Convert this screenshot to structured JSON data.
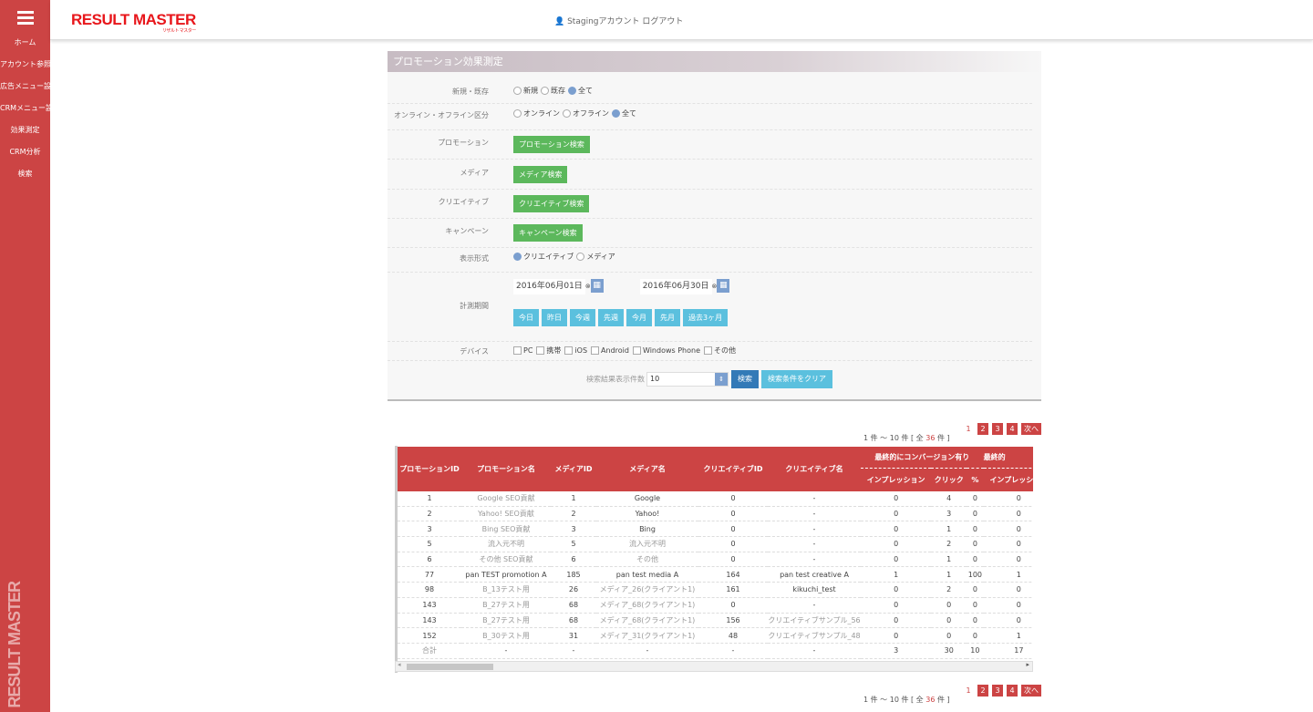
{
  "sidebar": {
    "items": [
      "ホーム",
      "アカウント参照",
      "広告メニュー設定",
      "CRMメニュー設...",
      "効果測定",
      "CRM分析",
      "検索"
    ],
    "vertical_logo": "RESULT MASTER"
  },
  "header": {
    "logo": "RESULT MASTER",
    "logo_sub": "リザルト マスター",
    "account": "Stagingアカウント",
    "logout": "ログアウト"
  },
  "panel": {
    "title": "プロモーション効果測定",
    "new_existing": {
      "label": "新規・既存",
      "options": [
        "新規",
        "既存",
        "全て"
      ],
      "selected": 2
    },
    "online": {
      "label": "オンライン・オフライン区分",
      "options": [
        "オンライン",
        "オフライン",
        "全て"
      ],
      "selected": 2
    },
    "promotion": {
      "label": "プロモーション",
      "button": "プロモーション検索"
    },
    "media": {
      "label": "メディア",
      "button": "メディア検索"
    },
    "creative": {
      "label": "クリエイティブ",
      "button": "クリエイティブ検索"
    },
    "campaign": {
      "label": "キャンペーン",
      "button": "キャンペーン検索"
    },
    "display": {
      "label": "表示形式",
      "options": [
        "クリエイティブ",
        "メディア"
      ],
      "selected": 0
    },
    "period": {
      "label": "計測期間",
      "from": "2016年06月01日",
      "to": "2016年06月30日",
      "quick": [
        "今日",
        "昨日",
        "今週",
        "先週",
        "今月",
        "先月",
        "過去3ヶ月"
      ]
    },
    "device": {
      "label": "デバイス",
      "options": [
        "PC",
        "携帯",
        "iOS",
        "Android",
        "Windows Phone",
        "その他"
      ]
    },
    "count": {
      "label": "検索結果表示件数",
      "value": "10"
    },
    "search": "検索",
    "clear": "検索条件をクリア"
  },
  "pager": {
    "from": "1",
    "to": "10",
    "total": "36",
    "pages": [
      "1",
      "2",
      "3",
      "4"
    ],
    "current": "1",
    "next": "次へ",
    "pre": "件 〜",
    "mid": "件 [ 全",
    "post": "件 ]"
  },
  "table": {
    "headers": [
      "プロモーションID",
      "プロモーション名",
      "メディアID",
      "メディア名",
      "クリエイティブID",
      "クリエイティブ名"
    ],
    "group1": "最終的にコンバージョン有り",
    "group2": "最終的",
    "sub": [
      "インプレッション",
      "クリック",
      "%",
      "インプレッション"
    ],
    "rows": [
      [
        "1",
        "Google SEO貢献",
        "1",
        "Google",
        "0",
        "-",
        "0",
        "4",
        "0",
        "0"
      ],
      [
        "2",
        "Yahoo! SEO貢献",
        "2",
        "Yahoo!",
        "0",
        "-",
        "0",
        "3",
        "0",
        "0"
      ],
      [
        "3",
        "Bing SEO貢献",
        "3",
        "Bing",
        "0",
        "-",
        "0",
        "1",
        "0",
        "0"
      ],
      [
        "5",
        "流入元不明",
        "5",
        "流入元不明",
        "0",
        "-",
        "0",
        "2",
        "0",
        "0"
      ],
      [
        "6",
        "その他 SEO貢献",
        "6",
        "その他",
        "0",
        "-",
        "0",
        "1",
        "0",
        "0"
      ],
      [
        "77",
        "pan TEST promotion A",
        "185",
        "pan test media A",
        "164",
        "pan test creative A",
        "1",
        "1",
        "100",
        "1"
      ],
      [
        "98",
        "B_13テスト用",
        "26",
        "メディア_26(クライアント1)",
        "161",
        "kikuchi_test",
        "0",
        "2",
        "0",
        "0"
      ],
      [
        "143",
        "B_27テスト用",
        "68",
        "メディア_68(クライアント1)",
        "0",
        "-",
        "0",
        "0",
        "0",
        "0"
      ],
      [
        "143",
        "B_27テスト用",
        "68",
        "メディア_68(クライアント1)",
        "156",
        "クリエイティブサンプル_56",
        "0",
        "0",
        "0",
        "0"
      ],
      [
        "152",
        "B_30テスト用",
        "31",
        "メディア_31(クライアント1)",
        "48",
        "クリエイティブサンプル_48",
        "0",
        "0",
        "0",
        "1"
      ],
      [
        "合計",
        "-",
        "-",
        "-",
        "-",
        "-",
        "3",
        "30",
        "10",
        "17"
      ]
    ]
  }
}
